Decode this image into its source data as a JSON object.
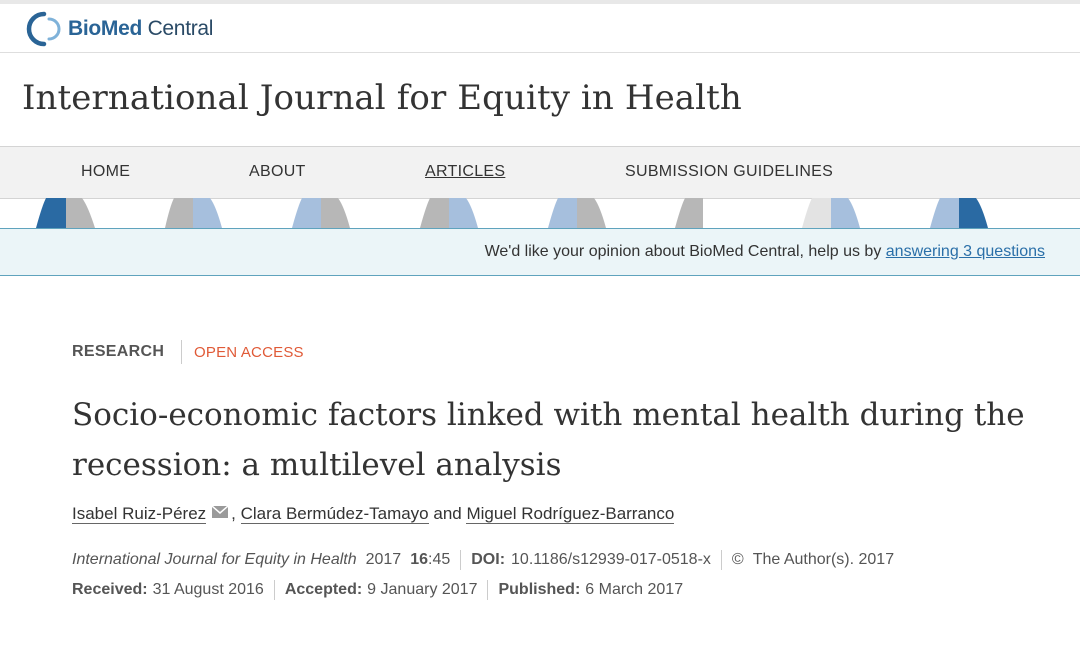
{
  "brand": {
    "logo_name_1": "BioMed",
    "logo_name_2": " Central"
  },
  "journal": {
    "title": "International Journal for Equity in Health"
  },
  "nav": {
    "home": "HOME",
    "about": "ABOUT",
    "articles": "ARTICLES",
    "submission": "SUBMISSION GUIDELINES",
    "active": "ARTICLES"
  },
  "banner": {
    "text": "We'd like your opinion about BioMed Central, help us by ",
    "link": "answering 3 questions"
  },
  "article": {
    "type": "RESEARCH",
    "access": "OPEN ACCESS",
    "title": "Socio-economic factors linked with mental health during the recession: a multilevel analysis",
    "authors": {
      "a1": "Isabel Ruiz-Pérez",
      "sep1": ", ",
      "a2": "Clara Bermúdez-Tamayo",
      "and": " and ",
      "a3": "Miguel Rodríguez-Barranco"
    },
    "citation": {
      "journal": "International Journal for Equity in Health",
      "year": "2017",
      "volume": "16",
      "article_no": ":45",
      "doi_label": "DOI:",
      "doi": "10.1186/s12939-017-0518-x",
      "copyright_symbol": "©",
      "copyright": "The Author(s). 2017"
    },
    "dates": {
      "received_label": "Received:",
      "received": "31 August 2016",
      "accepted_label": "Accepted:",
      "accepted": "9 January 2017",
      "published_label": "Published:",
      "published": "6 March 2017"
    }
  },
  "colors": {
    "brand_blue": "#2a6496",
    "open_access": "#e05a37",
    "banner_bg": "#ebf5f8",
    "banner_border": "#5fa3bd",
    "link": "#2a6fa8",
    "deco_dark_blue": "#2a6aa3",
    "deco_light_blue": "#a6bfdd",
    "deco_gray": "#b7b7b7"
  },
  "icons": {
    "logo": "biomed-central-logo-icon",
    "mail": "envelope-icon"
  }
}
